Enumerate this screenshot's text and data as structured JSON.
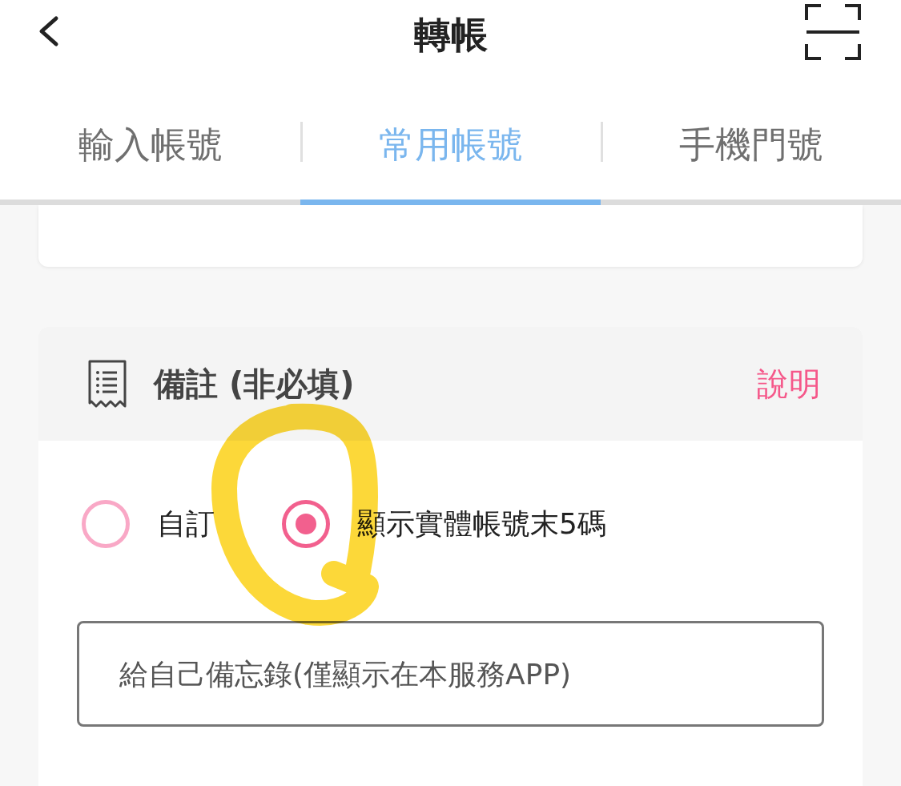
{
  "header": {
    "title": "轉帳"
  },
  "tabs": [
    {
      "label": "輸入帳號",
      "selected": false
    },
    {
      "label": "常用帳號",
      "selected": true
    },
    {
      "label": "手機門號",
      "selected": false
    }
  ],
  "memo_section": {
    "title": "備註 (非必填)",
    "help_link": "說明",
    "options": [
      {
        "label": "自訂",
        "selected": false
      },
      {
        "label": "顯示實體帳號末5碼",
        "selected": true
      }
    ],
    "memo_field": {
      "placeholder": "給自己備忘錄(僅顯示在本服務APP)"
    }
  }
}
